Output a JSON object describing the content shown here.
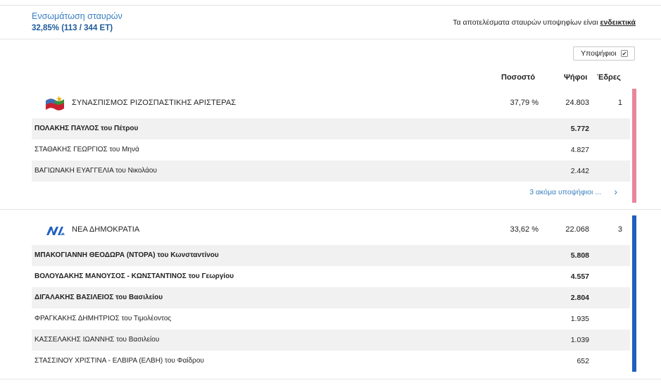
{
  "header": {
    "counting_label": "Ενσωμάτωση σταυρών",
    "counting_value": "32,85% (113 / 344 ΕΤ)",
    "notice_text": "Τα αποτελέσματα σταυρών υποψηφίων είναι ",
    "notice_link": "ενδεικτικά"
  },
  "toggle": {
    "label": "Υποψήφιοι",
    "checked_mark": "✔"
  },
  "columns": {
    "percent": "Ποσοστό",
    "votes": "Ψήφοι",
    "seats": "Έδρες"
  },
  "colors": {
    "syriza": "#e8879c",
    "nd": "#1f5fbf",
    "link": "#3a7fc1"
  },
  "parties": [
    {
      "name": "ΣΥΝΑΣΠΙΣΜΟΣ ΡΙΖΟΣΠΑΣΤΙΚΗΣ ΑΡΙΣΤΕΡΑΣ",
      "logo": "syriza-flag-logo",
      "percent": "37,79 %",
      "votes": "24.803",
      "seats": "1",
      "candidates": [
        {
          "name": "ΠΟΛΑΚΗΣ ΠΑΥΛΟΣ του Πέτρου",
          "votes": "5.772"
        },
        {
          "name": "ΣΤΑΘΑΚΗΣ ΓΕΩΡΓΙΟΣ του Μηνά",
          "votes": "4.827"
        },
        {
          "name": "ΒΑΓΙΩΝΑΚΗ ΕΥΑΓΓΕΛΙΑ του Νικολάου",
          "votes": "2.442"
        }
      ],
      "more_label": "3 ακόμα υποψήφιοι ..."
    },
    {
      "name": "ΝΕΑ ΔΗΜΟΚΡΑΤΙΑ",
      "logo": "nd-logo",
      "percent": "33,62 %",
      "votes": "22.068",
      "seats": "3",
      "candidates": [
        {
          "name": "ΜΠΑΚΟΓΙΑΝΝΗ ΘΕΟΔΩΡΑ (ΝΤΟΡΑ) του Κωνσταντίνου",
          "votes": "5.808"
        },
        {
          "name": "ΒΟΛΟΥΔΑΚΗΣ ΜΑΝΟΥΣΟΣ - ΚΩΝΣΤΑΝΤΙΝΟΣ του Γεωργίου",
          "votes": "4.557"
        },
        {
          "name": "ΔΙΓΑΛΑΚΗΣ ΒΑΣΙΛΕΙΟΣ του Βασιλείου",
          "votes": "2.804"
        },
        {
          "name": "ΦΡΑΓΚΑΚΗΣ ΔΗΜΗΤΡΙΟΣ του Τιμολέοντος",
          "votes": "1.935"
        },
        {
          "name": "ΚΑΣΣΕΛΑΚΗΣ ΙΩΑΝΝΗΣ του Βασιλείου",
          "votes": "1.039"
        },
        {
          "name": "ΣΤΑΣΣΙΝΟΥ ΧΡΙΣΤΙΝΑ - ΕΛΒΙΡΑ (ΕΛΒΗ) του Φαίδρου",
          "votes": "652"
        }
      ]
    }
  ]
}
